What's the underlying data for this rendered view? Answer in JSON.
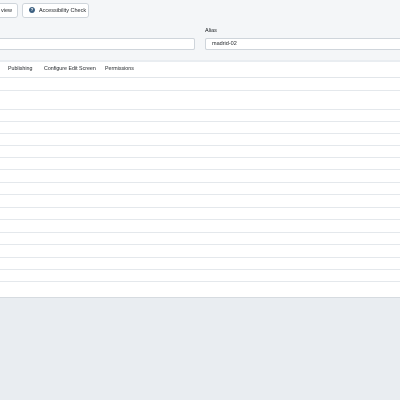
{
  "toolbar": {
    "preview_label": "view",
    "accessibility_label": "Accessibility Check",
    "help_glyph": "?"
  },
  "fields": {
    "title_value": "",
    "alias_label": "Alias",
    "alias_value": "madrid-02"
  },
  "tabs": [
    {
      "label": "Publishing"
    },
    {
      "label": "Configure Edit Screen"
    },
    {
      "label": "Permissions"
    }
  ],
  "icons": {
    "accessibility": "help-circle-icon"
  },
  "colors": {
    "background": "#e9edf1",
    "toolbar": "#f4f6f8",
    "icon_blue": "#3b5f80"
  }
}
